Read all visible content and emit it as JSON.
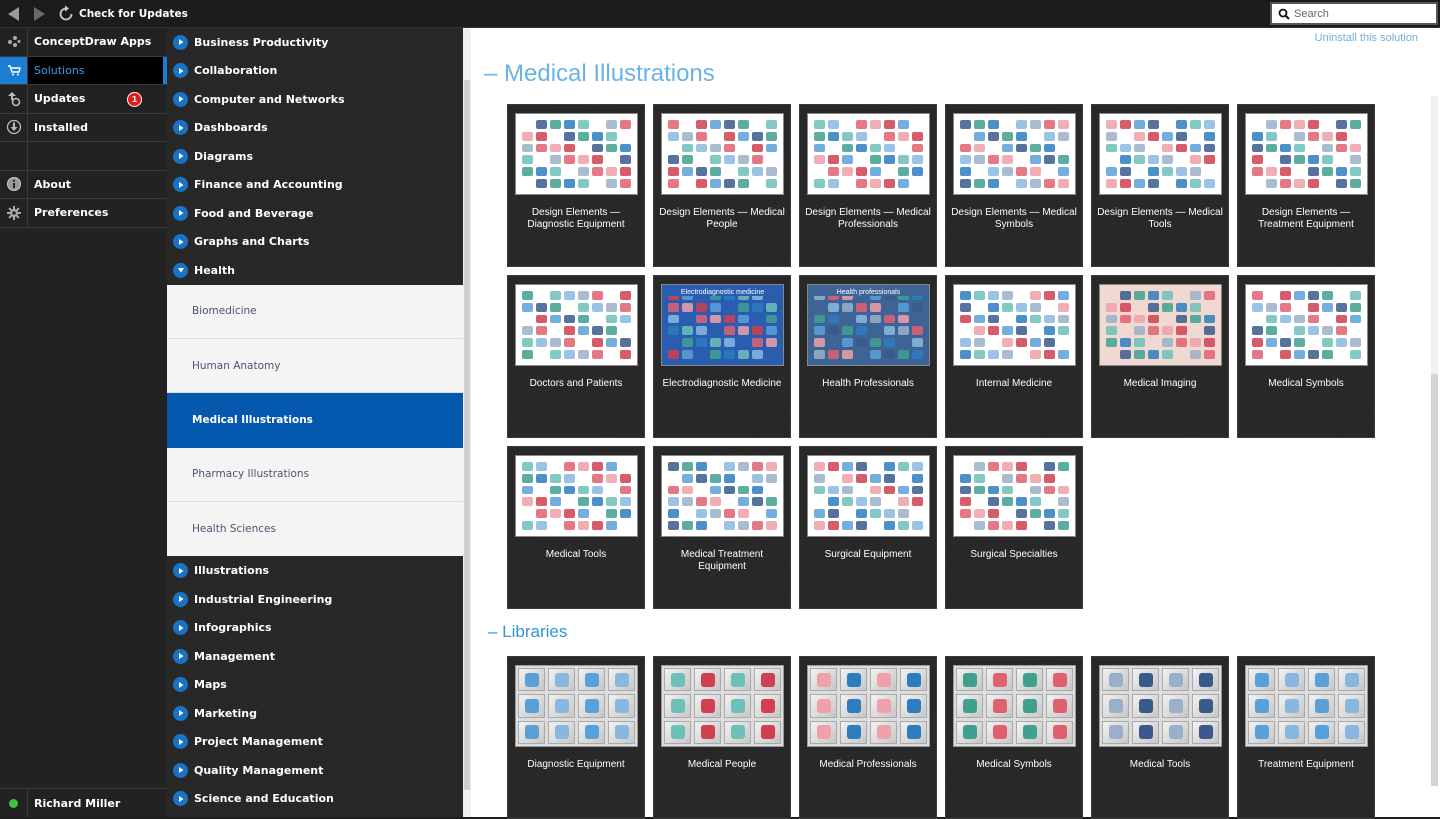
{
  "toolbar": {
    "back_icon": "back-arrow-icon",
    "forward_icon": "forward-arrow-icon",
    "refresh_icon": "refresh-icon",
    "check_updates_label": "Check for Updates",
    "search_placeholder": "Search",
    "search_value": ""
  },
  "leftnav": {
    "items": [
      {
        "label": "ConceptDraw Apps",
        "icon": "apps-icon"
      },
      {
        "label": "Solutions",
        "icon": "cart-icon",
        "active": true
      },
      {
        "label": "Updates",
        "icon": "updates-icon",
        "badge": "1"
      },
      {
        "label": "Installed",
        "icon": "download-icon"
      },
      {
        "label": "About",
        "icon": "info-icon"
      },
      {
        "label": "Preferences",
        "icon": "gear-icon"
      }
    ],
    "user": {
      "name": "Richard Miller",
      "status": "online",
      "status_color": "#3ec43e"
    }
  },
  "categories": {
    "before": [
      "Business Productivity",
      "Collaboration",
      "Computer and Networks",
      "Dashboards",
      "Diagrams",
      "Finance and Accounting",
      "Food and Beverage",
      "Graphs and Charts"
    ],
    "expanded": {
      "label": "Health",
      "children": [
        "Biomedicine",
        "Human Anatomy",
        "Medical Illustrations",
        "Pharmacy Illustrations",
        "Health Sciences"
      ],
      "active_child": "Medical Illustrations"
    },
    "after": [
      "Illustrations",
      "Industrial Engineering",
      "Infographics",
      "Management",
      "Maps",
      "Marketing",
      "Project Management",
      "Quality Management",
      "Science and Education"
    ]
  },
  "main": {
    "uninstall_label": "Uninstall this solution",
    "title": "– Medical Illustrations",
    "solutions": [
      {
        "label": "Design Elements — Diagnostic Equipment"
      },
      {
        "label": "Design Elements — Medical People"
      },
      {
        "label": "Design Elements — Medical Professionals"
      },
      {
        "label": "Design Elements — Medical Symbols"
      },
      {
        "label": "Design Elements — Medical Tools"
      },
      {
        "label": "Design Elements — Treatment Equipment"
      },
      {
        "label": "Doctors and Patients"
      },
      {
        "label": "Electrodiagnostic Medicine",
        "thumb_title": "Electrodiagnostic medicine"
      },
      {
        "label": "Health Professionals",
        "thumb_title": "Health professionals"
      },
      {
        "label": "Internal Medicine"
      },
      {
        "label": "Medical Imaging"
      },
      {
        "label": "Medical Symbols"
      },
      {
        "label": "Medical Tools"
      },
      {
        "label": "Medical Treatment Equipment"
      },
      {
        "label": "Surgical Equipment"
      },
      {
        "label": "Surgical Specialties"
      }
    ],
    "libraries_title": "– Libraries",
    "libraries": [
      {
        "label": "Diagnostic Equipment"
      },
      {
        "label": "Medical People"
      },
      {
        "label": "Medical Professionals"
      },
      {
        "label": "Medical Symbols"
      },
      {
        "label": "Medical Tools"
      },
      {
        "label": "Treatment Equipment"
      }
    ]
  },
  "colors": {
    "accent": "#1a7fd4",
    "selected_subcategory": "#0459ae",
    "section_title": "#6ab3e6",
    "badge": "#e31b1b"
  }
}
